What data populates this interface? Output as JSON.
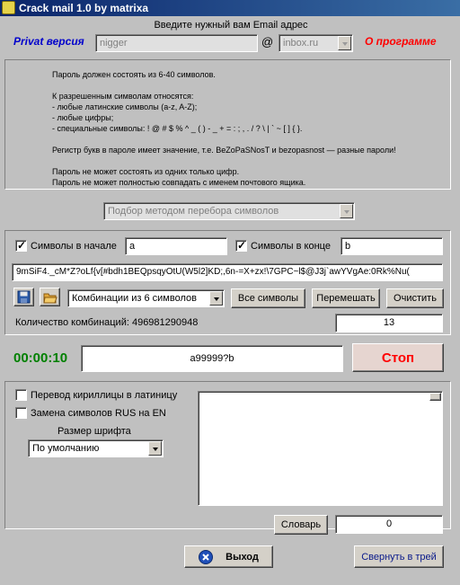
{
  "window": {
    "title": "Crack mail 1.0 by matrixa"
  },
  "header": {
    "email_prompt": "Введите нужный вам Email адрес",
    "privat_label": "Privat версия",
    "login_value": "nigger",
    "at_sign": "@",
    "domain_value": "inbox.ru",
    "about_label": "О программе",
    "colors": {
      "privat": "#0000cc",
      "about": "#ff0000"
    }
  },
  "info": {
    "lines": [
      "Пароль должен состоять из 6-40 символов.",
      "",
      "К разрешенным символам относятся:",
      "- любые латинские символы (a-z, A-Z);",
      "- любые цифры;",
      "- специальные символы: ! @ # $ % ^ _ ( ) - _ + = : ; , . / ? \\ | ` ~ [ ] { }.",
      "",
      "Регистр букв в пароле имеет значение, т.е. BeZoPaSNosT и bezopasnost — разные пароли!",
      "",
      "Пароль не может состоять из одних только цифр.",
      "Пароль не может полностью совпадать с именем почтового ящика."
    ]
  },
  "method": {
    "value": "Подбор методом перебора символов"
  },
  "charset": {
    "start_label": "Символы в начале",
    "start_checked": true,
    "start_value": "a",
    "end_label": "Символы в конце",
    "end_checked": true,
    "end_value": "b",
    "symbols": "9mSiF4._cM*Z?oLf{v[#bdh1BEQpsqyOtU(W5l2]KD;,6n-=X+zx!\\7GPC~l$@J3j`awYVgAe:0Rk%Nu(",
    "save_icon": "floppy-disk-icon",
    "open_icon": "folder-icon",
    "combinations_select": "Комбинации из 6 символов",
    "all_symbols_btn": "Все символы",
    "shuffle_btn": "Перемешать",
    "clear_btn": "Очистить",
    "count_label": "Количество комбинаций: 496981290948",
    "count_field": "13"
  },
  "progress": {
    "timer": "00:00:10",
    "current": "a99999?b",
    "stop_btn": "Стоп",
    "colors": {
      "timer": "#008000",
      "stop": "#ff0000"
    }
  },
  "options": {
    "translit_label": "Перевод кириллицы в латиницу",
    "translit_checked": false,
    "replace_label": "Замена символов RUS на EN",
    "replace_checked": false,
    "font_size_label": "Размер шрифта",
    "font_size_value": "По умолчанию",
    "dictionary_btn": "Словарь",
    "dictionary_count": "0"
  },
  "footer": {
    "exit_btn": "Выход",
    "exit_icon": "close-circle-icon",
    "tray_btn": "Свернуть в трей"
  }
}
